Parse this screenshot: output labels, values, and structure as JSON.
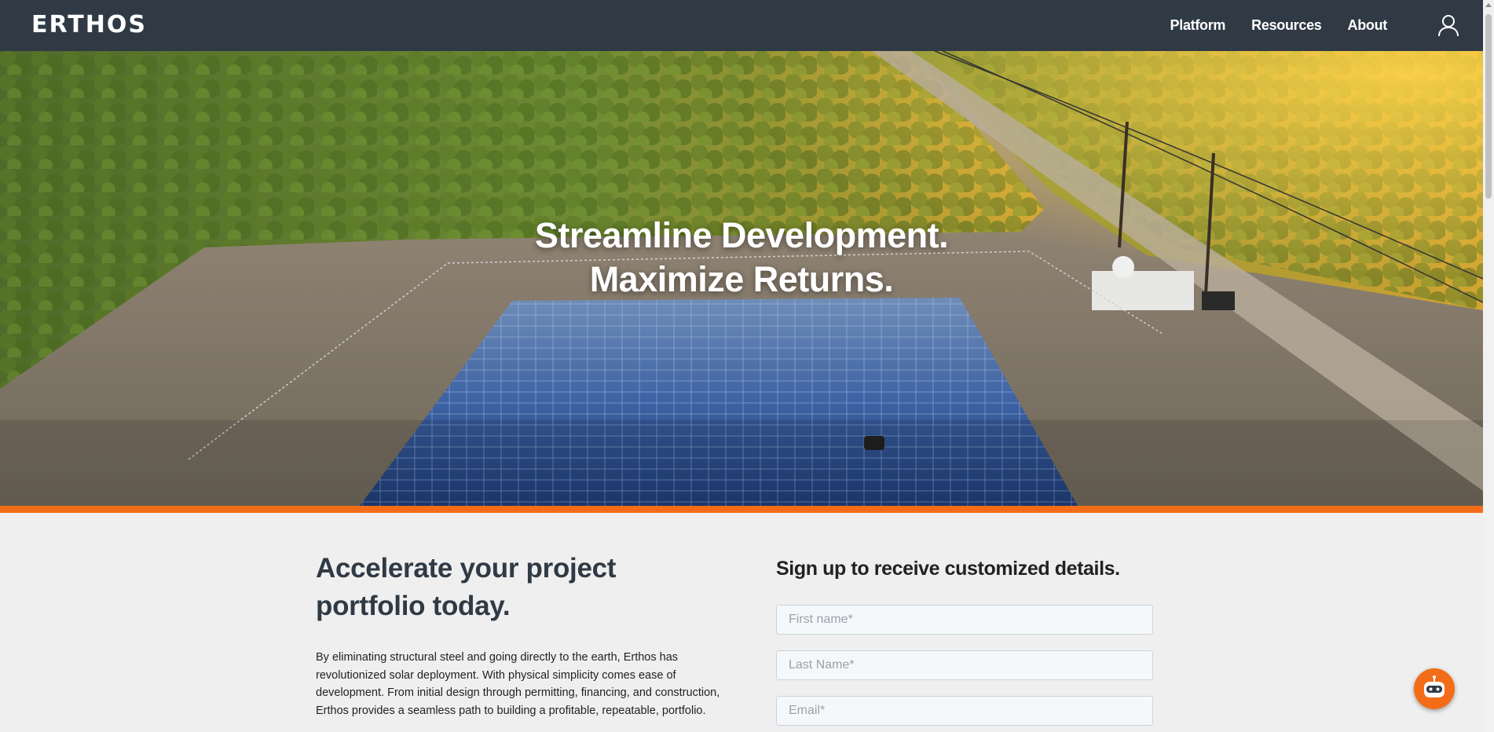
{
  "brand": {
    "logo_text": "ERTHOS"
  },
  "nav": {
    "links": [
      {
        "label": "Platform"
      },
      {
        "label": "Resources"
      },
      {
        "label": "About"
      }
    ],
    "account_icon": "user-icon"
  },
  "hero": {
    "line1": "Streamline Development.",
    "line2": "Maximize Returns."
  },
  "content": {
    "heading": "Accelerate your project portfolio today.",
    "body": "By eliminating structural steel and going directly to the earth, Erthos has revolutionized solar deployment. With physical simplicity comes ease of development. From initial design through permitting, financing, and construction, Erthos provides a seamless path to building a profitable, repeatable, portfolio."
  },
  "form": {
    "title": "Sign up to receive customized details.",
    "first_name_placeholder": "First name*",
    "last_name_placeholder": "Last Name*",
    "email_placeholder": "Email*"
  },
  "chat": {
    "icon": "robot-icon"
  },
  "colors": {
    "nav_bg": "#2f3a45",
    "accent": "#f36d18",
    "page_bg": "#efefef"
  }
}
